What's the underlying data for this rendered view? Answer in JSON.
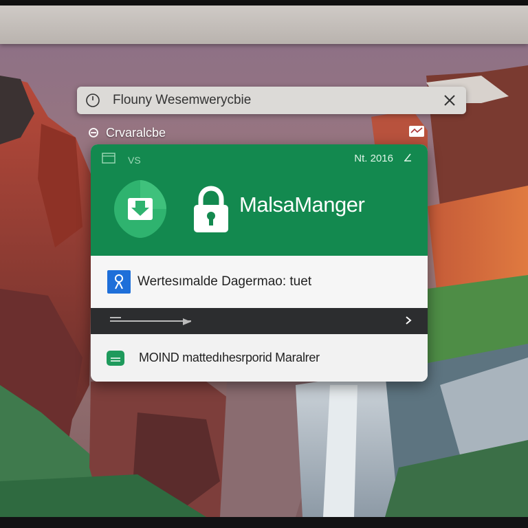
{
  "window": {
    "title": "Flouny Wesemwerycbie",
    "close_label": "close"
  },
  "subheader": {
    "label": "Crvaralcbe"
  },
  "card": {
    "meta_vs": "VS",
    "meta_year": "Nt. 2016",
    "app_name": "MalsaManger",
    "row_user_label": "Wertesımalde Dagermao: tuet",
    "row_monitor_label": "MOIND mattedıhesrporid Maralrer"
  },
  "colors": {
    "brand_green": "#13894f",
    "user_icon_blue": "#1e6fd9",
    "progress_bar": "#2c2d2f"
  },
  "icons": {
    "window": "clock-icon",
    "close": "close-icon",
    "subheader": "refresh-icon",
    "mail": "mail-icon",
    "app_logo": "download-shield-icon",
    "lock": "lock-icon",
    "user": "user-icon",
    "next": "chevron-right-icon",
    "monitor": "monitor-icon"
  }
}
